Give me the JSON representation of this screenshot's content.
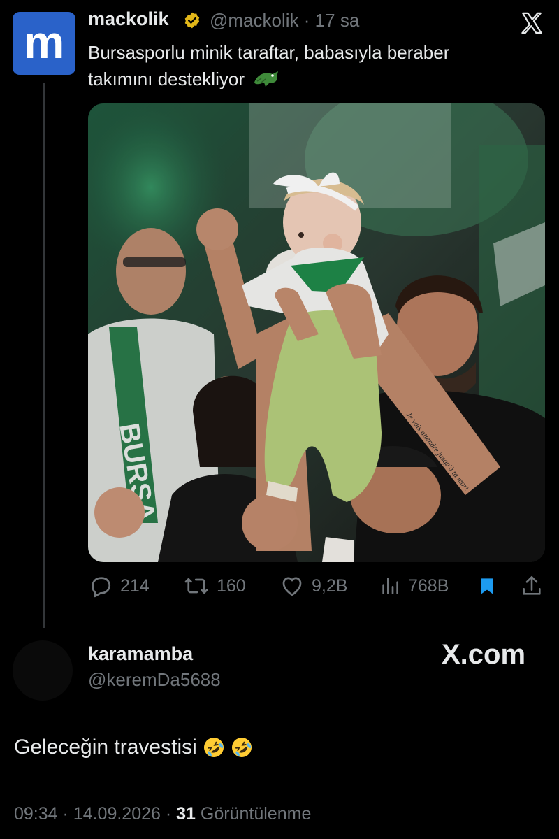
{
  "tweet": {
    "avatar_letter": "m",
    "author_name": "mackolik",
    "author_handle": "@mackolik",
    "time_ago": "17 sa",
    "text_line1": "Bursasporlu minik taraftar, babasıyla beraber",
    "text_line2": "takımını destekliyor",
    "emoji_icon": "crocodile-icon",
    "media": {
      "description_icon": "photo",
      "tattoo_text": "Je vais attendre jusqu'à ta mort",
      "scarf_text": "BURSA"
    },
    "stats": {
      "replies": "214",
      "reposts": "160",
      "likes": "9,2B",
      "views": "768B"
    },
    "icons": [
      "reply-icon",
      "repost-icon",
      "like-icon",
      "views-icon",
      "bookmark-icon",
      "share-icon",
      "x-logo-icon"
    ]
  },
  "reply": {
    "author_name": "karamamba",
    "author_handle": "@keremDa5688",
    "watermark": "X.com",
    "text": "Geleceğin travestisi",
    "emoji_icons": [
      "rolling-laughing-icon",
      "rolling-laughing-icon"
    ],
    "time": "09:34",
    "date": "14.09.2026",
    "views_count": "31",
    "views_label": "Görüntülenme"
  },
  "colors": {
    "background": "#000000",
    "text": "#e7e9ea",
    "muted": "#71767b",
    "bookmark_active": "#1d9bf0",
    "verified_gold": "#e2b719",
    "avatar_blue": "#2a62c9"
  }
}
